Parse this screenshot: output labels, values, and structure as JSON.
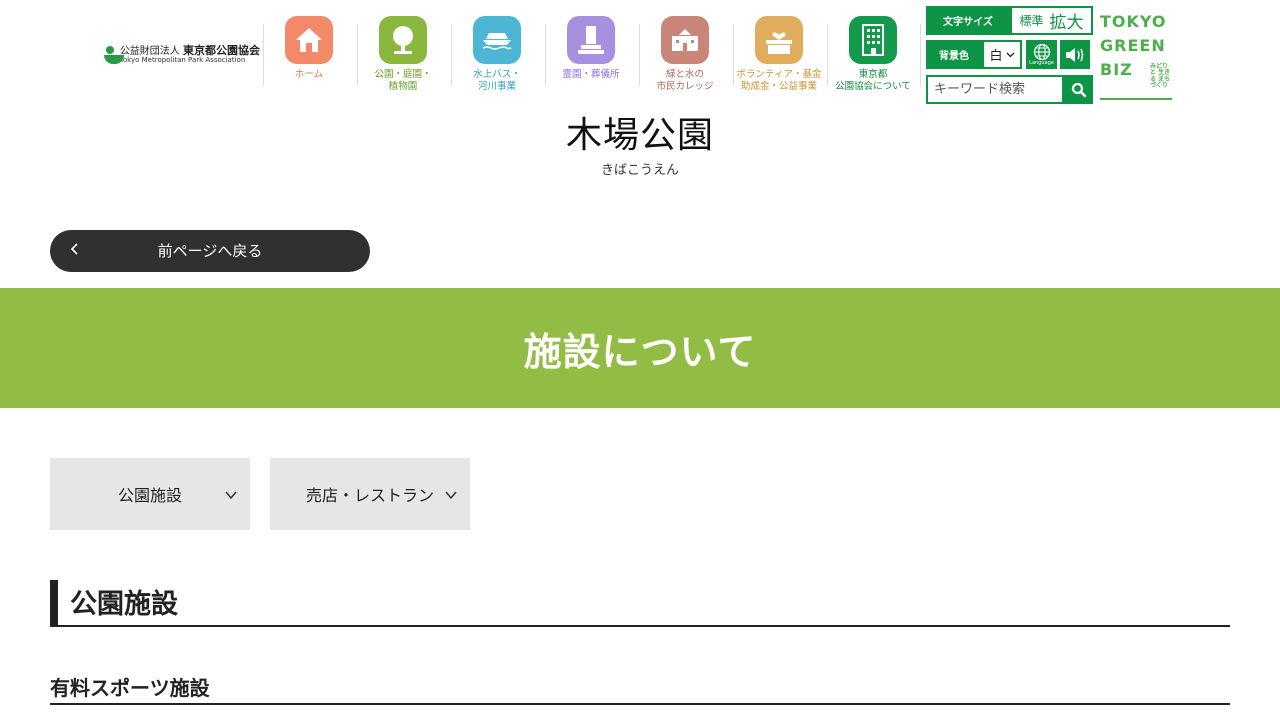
{
  "header": {
    "logo": {
      "jp_prefix": "公益財団法人",
      "jp_name": "東京都公園協会",
      "en": "Tokyo Metropolitan Park Association"
    },
    "nav": [
      {
        "label": "ホーム",
        "icon": "home-icon",
        "color": "#f4896a",
        "text_color": "#e8734f"
      },
      {
        "label": "公園・庭園・\n植物園",
        "icon": "tree-icon",
        "color": "#8ab83e",
        "text_color": "#6a9e2c"
      },
      {
        "label": "水上バス・\n河川事業",
        "icon": "boat-icon",
        "color": "#4cb6d4",
        "text_color": "#2f9ec0"
      },
      {
        "label": "霊園・葬儀所",
        "icon": "monument-icon",
        "color": "#a890e0",
        "text_color": "#8b6fd6"
      },
      {
        "label": "緑と水の\n市民カレッジ",
        "icon": "school-icon",
        "color": "#c9857a",
        "text_color": "#b0675a"
      },
      {
        "label": "ボランティア・基金\n助成金・公益事業",
        "icon": "heart-box-icon",
        "color": "#e0ac5e",
        "text_color": "#cf9233"
      },
      {
        "label": "東京都\n公園協会について",
        "icon": "building-icon",
        "color": "#149a4c",
        "text_color": "#138a42"
      }
    ],
    "utility": {
      "font_size_label": "文字サイズ",
      "font_standard": "標準",
      "font_large": "拡大",
      "bg_color_label": "背景色",
      "bg_color_value": "白",
      "language_label": "Language",
      "search_placeholder": "キーワード検索"
    },
    "tgb": {
      "line1": "TOKYO",
      "line2": "GREEN",
      "line3": "BIZ",
      "sub": "みどりと 生きる まちづくり"
    }
  },
  "page": {
    "title": "木場公園",
    "title_kana": "きばこうえん",
    "back_label": "前ページへ戻る",
    "banner_title": "施設について",
    "tabs": [
      {
        "label": "公園施設"
      },
      {
        "label": "売店・レストラン"
      }
    ],
    "section_title": "公園施設",
    "subsection_title": "有料スポーツ施設"
  },
  "colors": {
    "brand_green": "#0d9444",
    "banner_green": "#93bc44",
    "dark": "#303030"
  }
}
